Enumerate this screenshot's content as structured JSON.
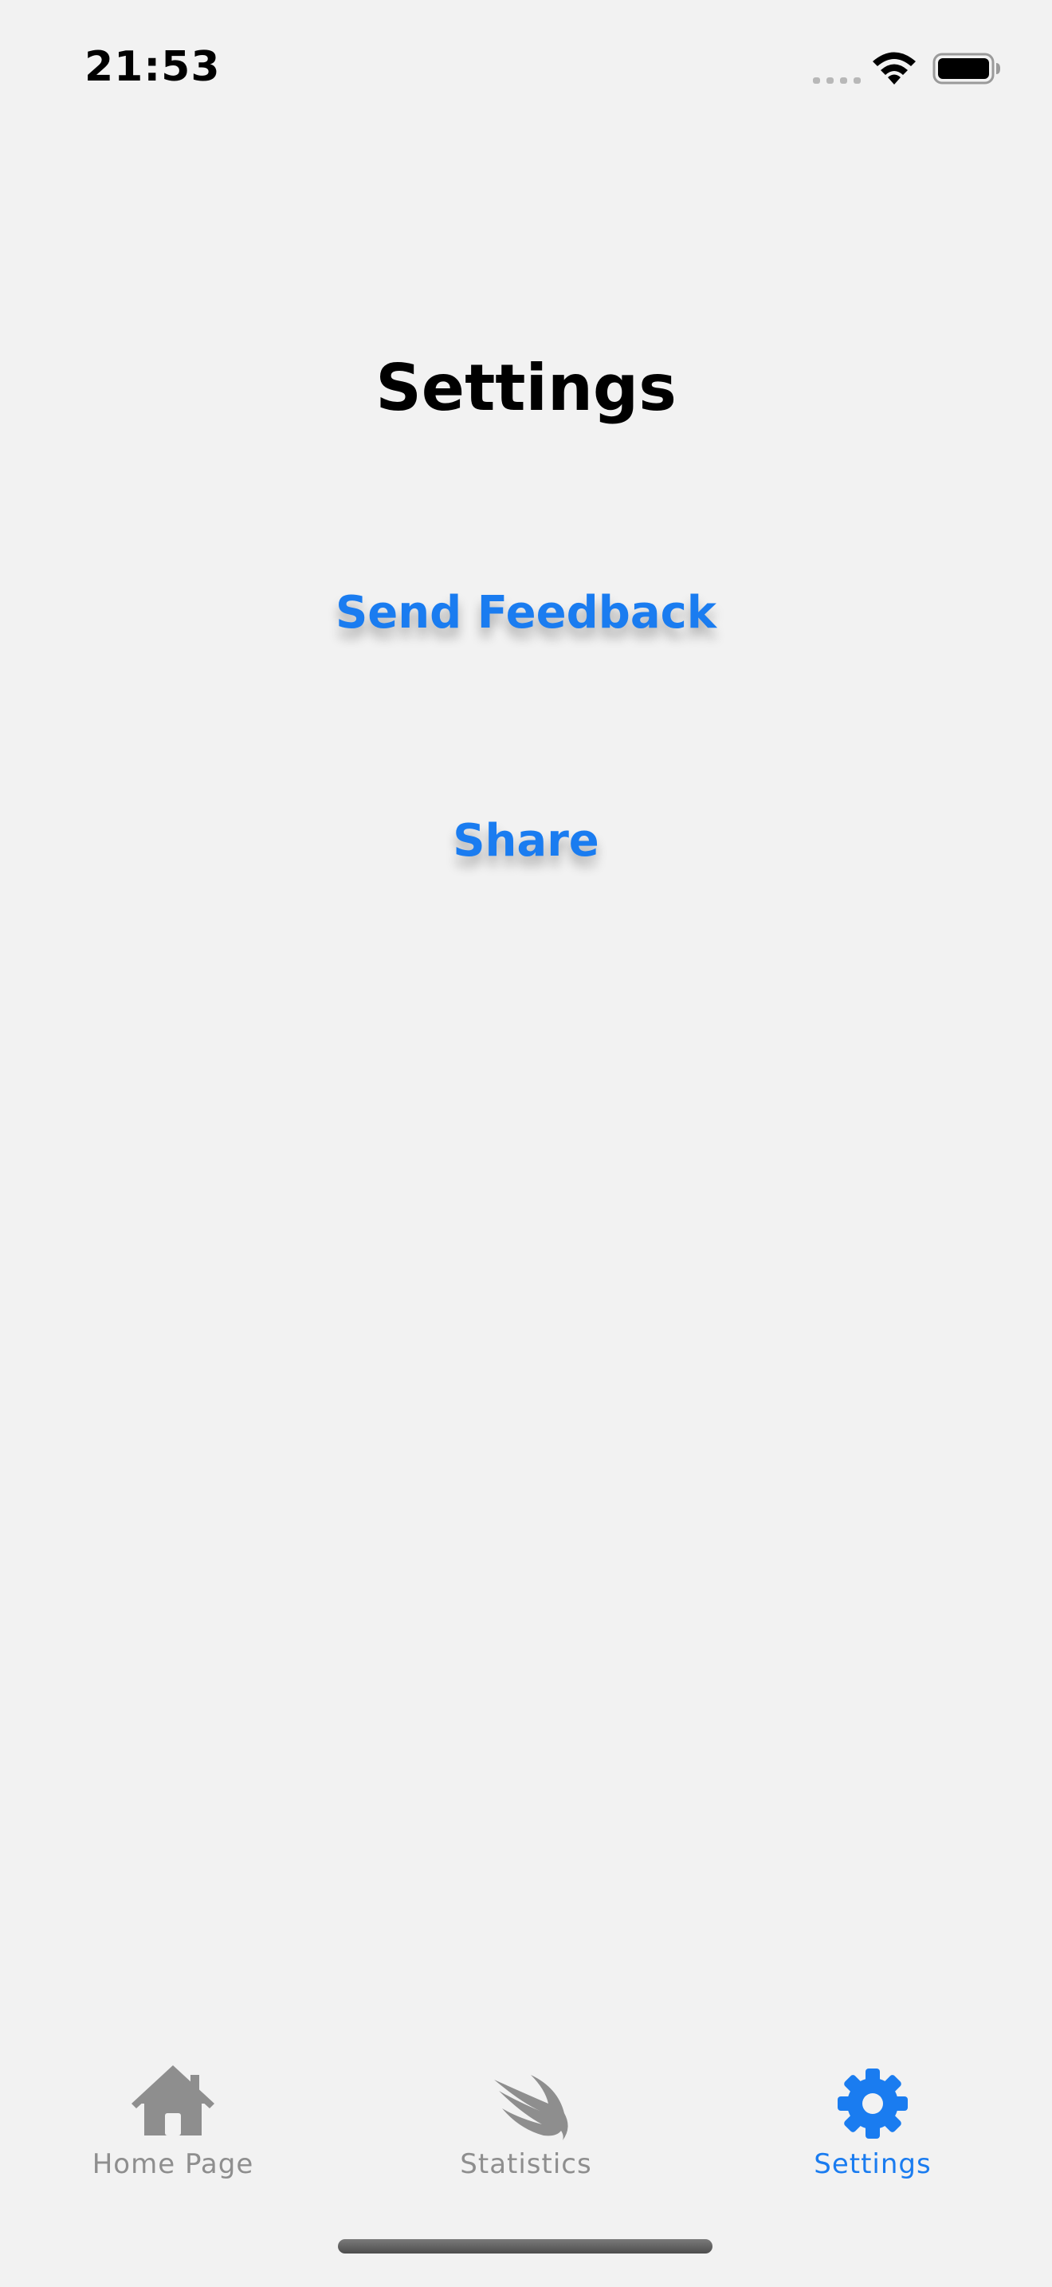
{
  "status_bar": {
    "time": "21:53",
    "icons": [
      "cellular-signal-icon",
      "wifi-icon",
      "battery-icon"
    ]
  },
  "page": {
    "title": "Settings"
  },
  "actions": {
    "send_feedback_label": "Send Feedback",
    "share_label": "Share"
  },
  "tab_bar": {
    "selected": "Settings",
    "tabs": [
      {
        "label": "Home Page",
        "icon": "house-icon",
        "active": false
      },
      {
        "label": "Statistics",
        "icon": "swift-bird-icon",
        "active": false
      },
      {
        "label": "Settings",
        "icon": "gear-icon",
        "active": true
      }
    ]
  },
  "colors": {
    "accent": "#1a7cf0",
    "inactive": "#8e8e8e",
    "background": "#f2f2f2",
    "title": "#000000"
  }
}
